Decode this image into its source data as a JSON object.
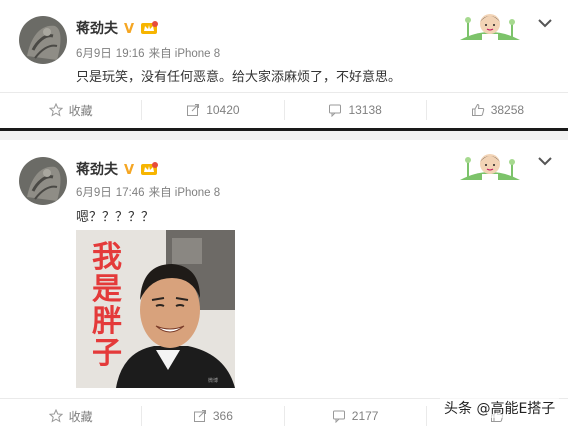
{
  "posts": [
    {
      "author": "蒋劲夫",
      "date": "6月9日",
      "time": "19:16",
      "source": "来自 iPhone 8",
      "text": "只是玩笑，没有任何恶意。给大家添麻烦了，不好意思。",
      "actions": {
        "fav": "收藏",
        "repost": "10420",
        "comment": "13138",
        "like": "38258"
      }
    },
    {
      "author": "蒋劲夫",
      "date": "6月9日",
      "time": "17:46",
      "source": "来自 iPhone 8",
      "text": "嗯？？？？？",
      "image_caption": "我是胖子",
      "actions": {
        "fav": "收藏",
        "repost": "366",
        "comment": "2177"
      }
    }
  ],
  "watermark": "头条 @高能E搭子",
  "colors": {
    "caption": "#e43a3a",
    "text_gray": "#808080",
    "vip": "#f5a623"
  }
}
